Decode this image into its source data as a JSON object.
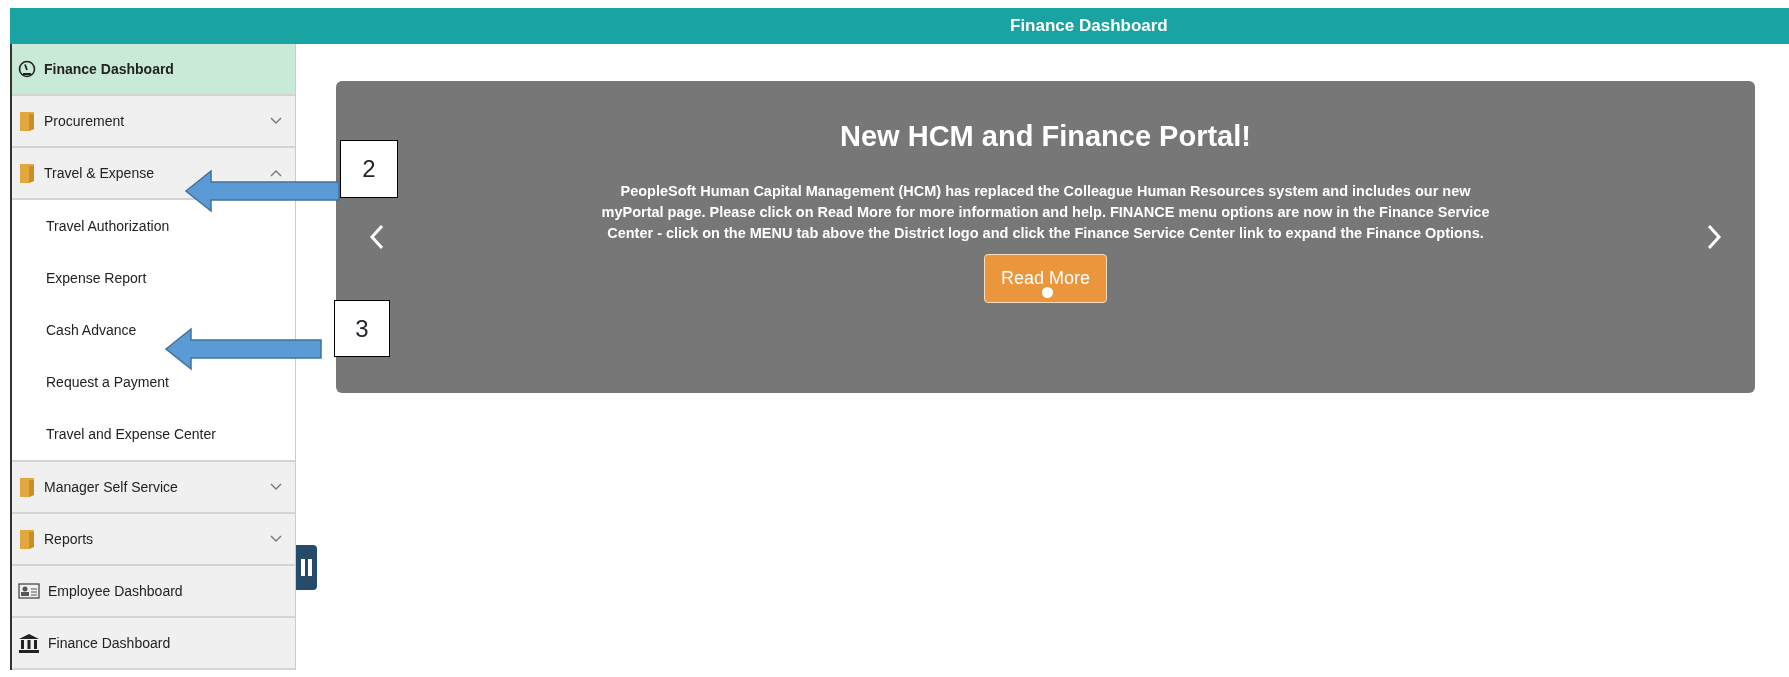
{
  "header": {
    "title": "Finance Dashboard"
  },
  "sidebar": {
    "items": [
      {
        "kind": "dashboard",
        "label": "Finance Dashboard",
        "selected": true
      },
      {
        "kind": "group",
        "label": "Procurement",
        "selected": false,
        "expanded": false
      },
      {
        "kind": "group",
        "label": "Travel & Expense",
        "selected": false,
        "expanded": true,
        "children": [
          {
            "label": "Travel Authorization"
          },
          {
            "label": "Expense Report"
          },
          {
            "label": "Cash Advance"
          },
          {
            "label": "Request a Payment"
          },
          {
            "label": "Travel and Expense Center"
          }
        ]
      },
      {
        "kind": "group",
        "label": "Manager Self Service",
        "selected": false,
        "expanded": false
      },
      {
        "kind": "group",
        "label": "Reports",
        "selected": false,
        "expanded": false
      },
      {
        "kind": "employee",
        "label": "Employee Dashboard",
        "selected": false
      },
      {
        "kind": "finance",
        "label": "Finance Dashboard",
        "selected": false
      }
    ]
  },
  "carousel": {
    "title": "New HCM and Finance Portal!",
    "body": "PeopleSoft Human Capital Management (HCM) has replaced the Colleague Human Resources system and includes our new myPortal page. Please click on Read More for more information and help. FINANCE menu options are now in the Finance Service Center - click on the MENU tab above the District logo and click the Finance Service Center link to expand the Finance Options.",
    "button": "Read More"
  },
  "callouts": [
    {
      "label": "2"
    },
    {
      "label": "3"
    }
  ]
}
